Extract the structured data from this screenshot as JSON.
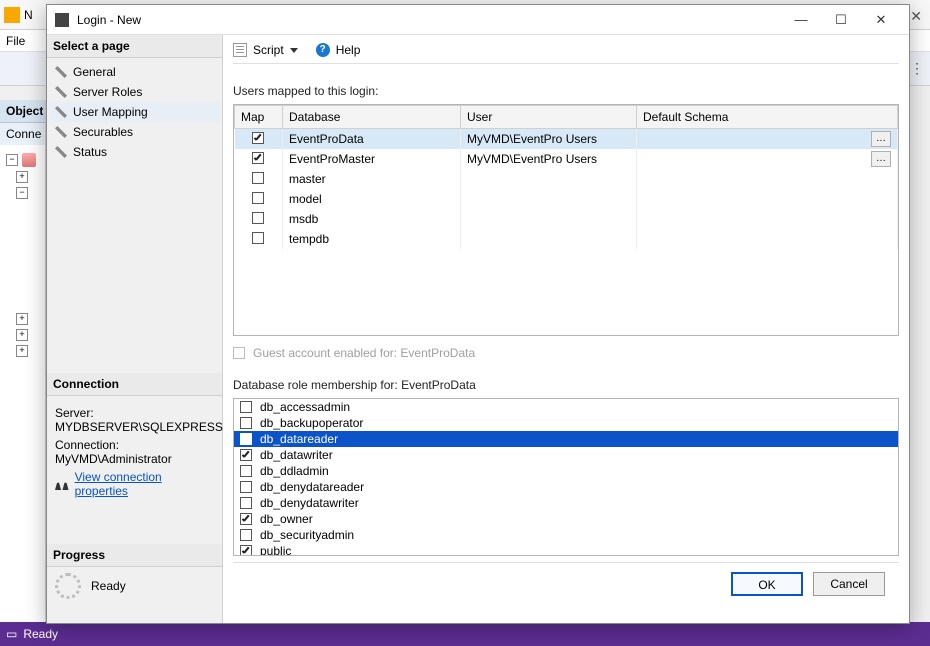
{
  "bg": {
    "menu_file": "File",
    "object_panel": "Object",
    "conne_label": "Conne",
    "status_text": "Ready",
    "top_initial": "N"
  },
  "dlg": {
    "title": "Login - New",
    "select_page_header": "Select a page",
    "pages": [
      {
        "label": "General",
        "selected": false
      },
      {
        "label": "Server Roles",
        "selected": false
      },
      {
        "label": "User Mapping",
        "selected": true
      },
      {
        "label": "Securables",
        "selected": false
      },
      {
        "label": "Status",
        "selected": false
      }
    ],
    "connection_header": "Connection",
    "server_label": "Server:",
    "server_value": "MYDBSERVER\\SQLEXPRESS",
    "connection_label": "Connection:",
    "connection_value": "MyVMD\\Administrator",
    "view_conn_link": "View connection properties",
    "progress_header": "Progress",
    "progress_text": "Ready",
    "toolbar": {
      "script": "Script",
      "help": "Help"
    },
    "users_mapped_label": "Users mapped to this login:",
    "map_header": "Map",
    "db_header": "Database",
    "user_header": "User",
    "schema_header": "Default Schema",
    "rows": [
      {
        "map": true,
        "db": "EventProData",
        "user": "MyVMD\\EventPro Users",
        "schema": "",
        "selected": true,
        "hasEllipsis": true
      },
      {
        "map": true,
        "db": "EventProMaster",
        "user": "MyVMD\\EventPro Users",
        "schema": "",
        "selected": false,
        "hasEllipsis": true
      },
      {
        "map": false,
        "db": "master",
        "user": "",
        "schema": "",
        "selected": false,
        "hasEllipsis": false
      },
      {
        "map": false,
        "db": "model",
        "user": "",
        "schema": "",
        "selected": false,
        "hasEllipsis": false
      },
      {
        "map": false,
        "db": "msdb",
        "user": "",
        "schema": "",
        "selected": false,
        "hasEllipsis": false
      },
      {
        "map": false,
        "db": "tempdb",
        "user": "",
        "schema": "",
        "selected": false,
        "hasEllipsis": false
      }
    ],
    "guest_label": "Guest account enabled for: EventProData",
    "roles_label": "Database role membership for: EventProData",
    "roles": [
      {
        "name": "db_accessadmin",
        "checked": false,
        "sel": false
      },
      {
        "name": "db_backupoperator",
        "checked": false,
        "sel": false
      },
      {
        "name": "db_datareader",
        "checked": true,
        "sel": true
      },
      {
        "name": "db_datawriter",
        "checked": true,
        "sel": false
      },
      {
        "name": "db_ddladmin",
        "checked": false,
        "sel": false
      },
      {
        "name": "db_denydatareader",
        "checked": false,
        "sel": false
      },
      {
        "name": "db_denydatawriter",
        "checked": false,
        "sel": false
      },
      {
        "name": "db_owner",
        "checked": true,
        "sel": false
      },
      {
        "name": "db_securityadmin",
        "checked": false,
        "sel": false
      },
      {
        "name": "public",
        "checked": true,
        "sel": false
      }
    ],
    "ok": "OK",
    "cancel": "Cancel"
  }
}
